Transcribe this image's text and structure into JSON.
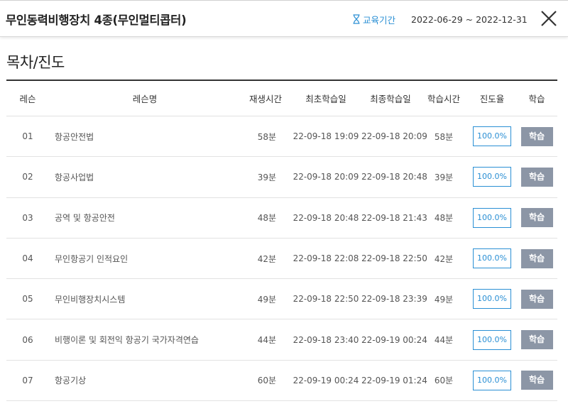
{
  "header": {
    "course_title": "무인동력비행장치 4종(무인멀티콥터)",
    "period_label": "교육기간",
    "period_dates": "2022-06-29 ~ 2022-12-31",
    "period_icon": "hourglass-icon",
    "close_icon": "close-icon",
    "accent_color": "#2a8fd4"
  },
  "section_title": "목차/진도",
  "table": {
    "columns": {
      "lesson": "레슨",
      "lesson_name": "레슨명",
      "play_time": "재생시간",
      "first_study": "최초학습일",
      "last_study": "최종학습일",
      "study_time": "학습시간",
      "progress": "진도율",
      "learn": "학습"
    },
    "rows": [
      {
        "num": "01",
        "name": "항공안전법",
        "play": "58분",
        "first": "22-09-18 19:09",
        "last": "22-09-18 20:09",
        "time": "58분",
        "progress": "100.0%",
        "button": "학습"
      },
      {
        "num": "02",
        "name": "항공사업법",
        "play": "39분",
        "first": "22-09-18 20:09",
        "last": "22-09-18 20:48",
        "time": "39분",
        "progress": "100.0%",
        "button": "학습"
      },
      {
        "num": "03",
        "name": "공역 및 항공안전",
        "play": "48분",
        "first": "22-09-18 20:48",
        "last": "22-09-18 21:43",
        "time": "48분",
        "progress": "100.0%",
        "button": "학습"
      },
      {
        "num": "04",
        "name": "무인항공기 인적요인",
        "play": "42분",
        "first": "22-09-18 22:08",
        "last": "22-09-18 22:50",
        "time": "42분",
        "progress": "100.0%",
        "button": "학습"
      },
      {
        "num": "05",
        "name": "무인비행장치시스템",
        "play": "49분",
        "first": "22-09-18 22:50",
        "last": "22-09-18 23:39",
        "time": "49분",
        "progress": "100.0%",
        "button": "학습"
      },
      {
        "num": "06",
        "name": "비행이론 및 회전익 항공기 국가자격연습",
        "play": "44분",
        "first": "22-09-18 23:40",
        "last": "22-09-19 00:24",
        "time": "44분",
        "progress": "100.0%",
        "button": "학습"
      },
      {
        "num": "07",
        "name": "항공기상",
        "play": "60분",
        "first": "22-09-19 00:24",
        "last": "22-09-19 01:24",
        "time": "60분",
        "progress": "100.0%",
        "button": "학습"
      }
    ]
  }
}
